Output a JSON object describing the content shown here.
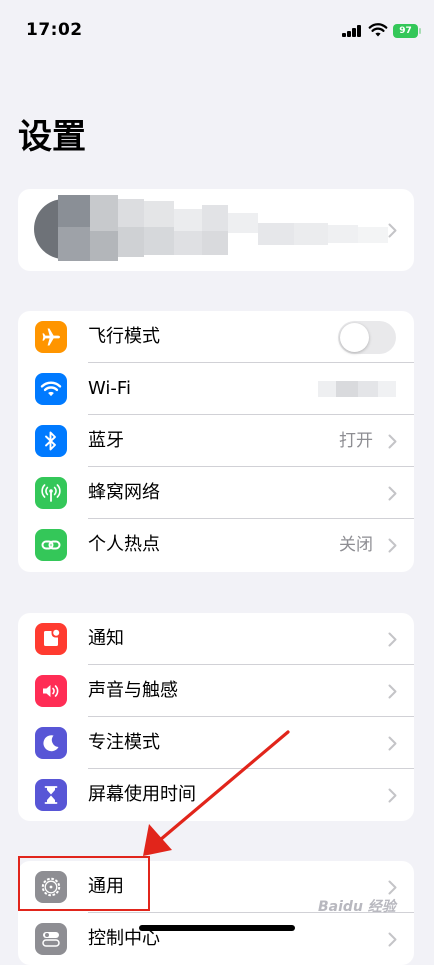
{
  "status_bar": {
    "time": "17:02",
    "battery": "97"
  },
  "page_title": "设置",
  "colors": {
    "airplane": "#ff9500",
    "wifi": "#007aff",
    "bluetooth": "#007aff",
    "cellular": "#34c759",
    "hotspot": "#34c759",
    "notifications": "#ff3b30",
    "sounds": "#ff2d55",
    "focus": "#5856d6",
    "screen_time": "#5856d6",
    "general": "#8e8e93",
    "control_center": "#8e8e93",
    "annotation": "#e1251b"
  },
  "groups": {
    "connectivity": [
      {
        "label": "飞行模式",
        "icon": "airplane-icon",
        "control": "toggle",
        "on": false
      },
      {
        "label": "Wi-Fi",
        "icon": "wifi-icon",
        "value": ""
      },
      {
        "label": "蓝牙",
        "icon": "bluetooth-icon",
        "value": "打开"
      },
      {
        "label": "蜂窝网络",
        "icon": "antenna-icon",
        "value": ""
      },
      {
        "label": "个人热点",
        "icon": "link-icon",
        "value": "关闭"
      }
    ],
    "notifications": [
      {
        "label": "通知",
        "icon": "bell-icon"
      },
      {
        "label": "声音与触感",
        "icon": "speaker-icon"
      },
      {
        "label": "专注模式",
        "icon": "moon-icon"
      },
      {
        "label": "屏幕使用时间",
        "icon": "hourglass-icon"
      }
    ],
    "system": [
      {
        "label": "通用",
        "icon": "gear-icon"
      },
      {
        "label": "控制中心",
        "icon": "switches-icon"
      }
    ]
  },
  "watermark": "Baidu 经验"
}
